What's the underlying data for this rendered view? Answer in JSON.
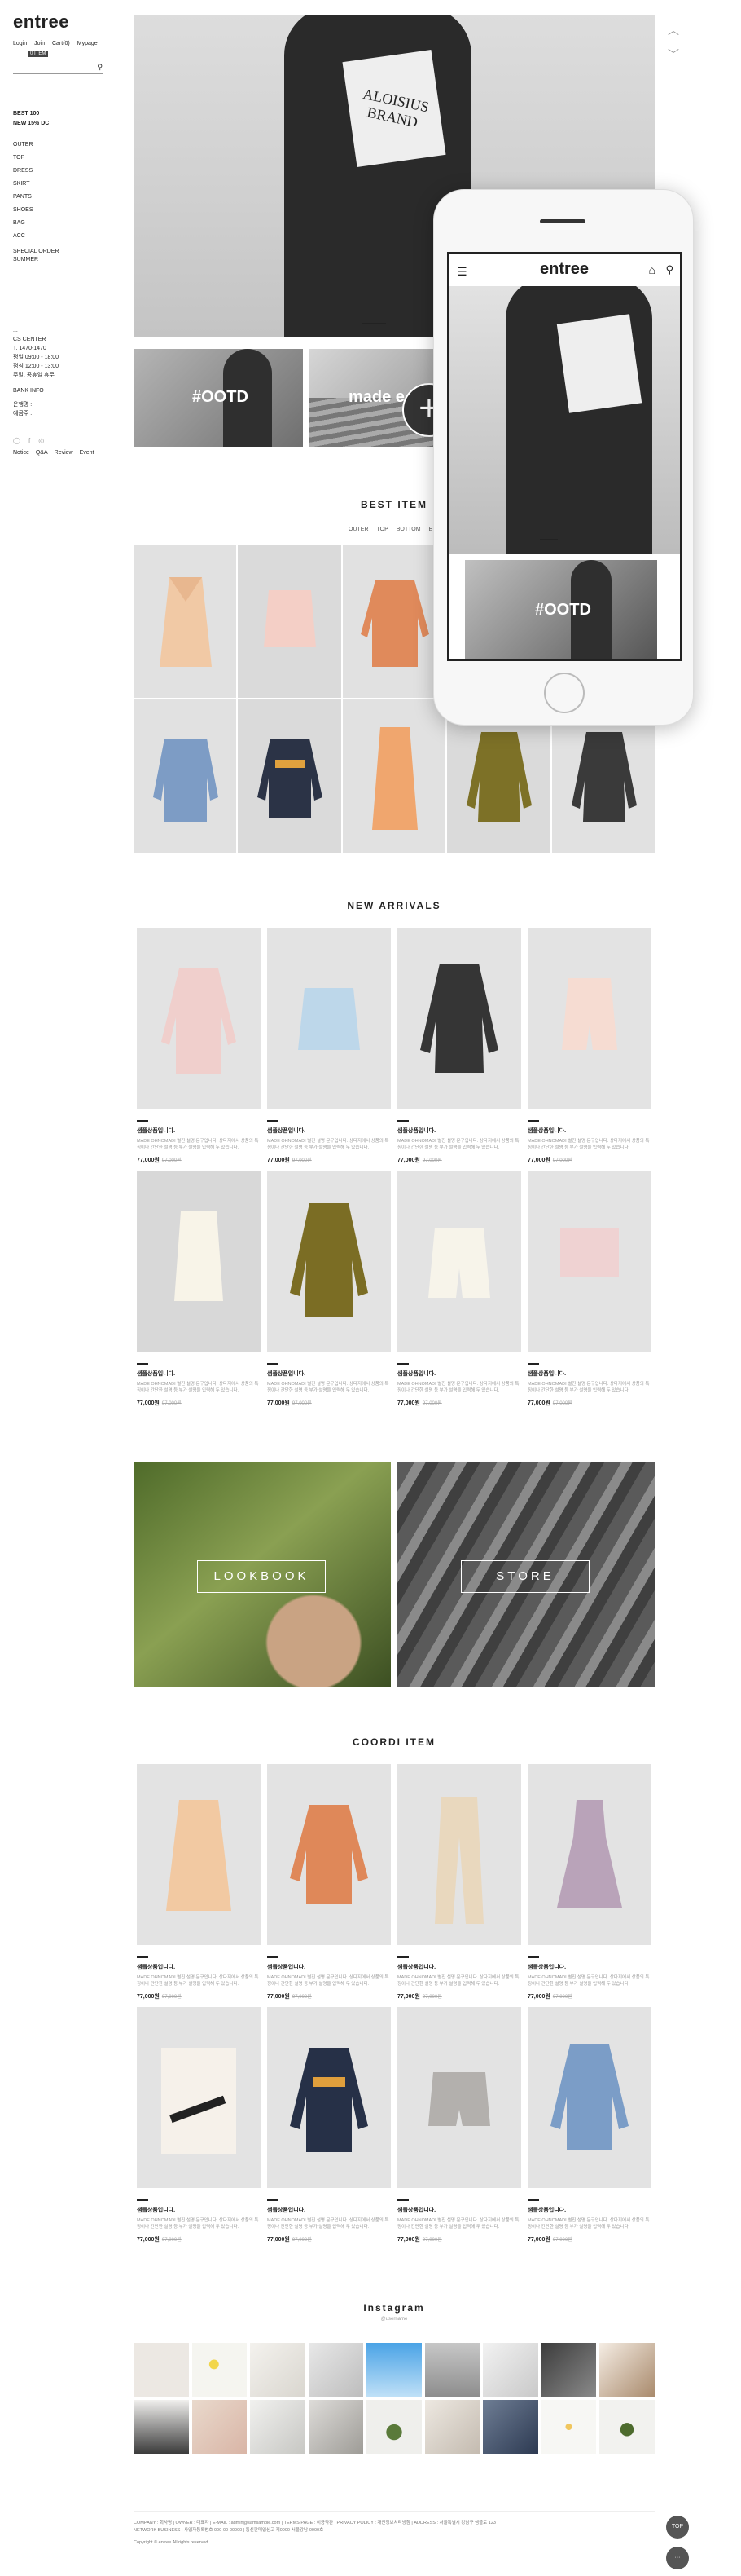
{
  "brand": {
    "logo": "entree",
    "mobile_logo": "entree"
  },
  "top_links": [
    "Login",
    "Join",
    "Cart(0)",
    "Mypage"
  ],
  "cart_badge": "0 ITEM",
  "sidebar_menu_primary": [
    "BEST 100",
    "NEW 15% DC"
  ],
  "sidebar_menu": [
    "OUTER",
    "TOP",
    "DRESS",
    "SKIRT",
    "PANTS",
    "SHOES",
    "BAG",
    "ACC",
    "SPECIAL ORDER",
    "SUMMER"
  ],
  "cs_center": {
    "dots": "...",
    "title": "CS CENTER",
    "phone": "T. 1470-1470",
    "hours": [
      "평일 09:00 - 18:00",
      "점심 12:00 - 13:00",
      "주말, 공휴일 휴무"
    ],
    "bank_title": "BANK INFO",
    "bank_lines": [
      "은행명 :",
      "예금주 :"
    ]
  },
  "sns": [
    "◯",
    "f",
    "◎"
  ],
  "bottom_links": [
    "Notice",
    "Q&A",
    "Review",
    "Event"
  ],
  "hero": {
    "print_text": "ALOISIUS BRAND"
  },
  "thumbs": [
    "#OOTD",
    "made e"
  ],
  "mobile_thumb": "#OOTD",
  "best_item": {
    "title": "BEST ITEM",
    "tabs": [
      "OUTER",
      "TOP",
      "BOTTOM",
      "E"
    ]
  },
  "new_arrivals": {
    "title": "NEW ARRIVALS",
    "products": [
      {
        "name": "샘플상품입니다.",
        "desc": "MADE OHNOMADI 별진 설명 문구입니다. 상다지에서 상품의 특징이나 간단한 설명 등 부가 설명을 입력해 두 있습니다.",
        "price": "77,000원",
        "orig": "97,000원"
      },
      {
        "name": "샘플상품입니다.",
        "desc": "MADE OHNOMADI 별진 설명 문구입니다. 상다지에서 상품의 특징이나 간단한 설명 등 부가 설명을 입력해 두 있습니다.",
        "price": "77,000원",
        "orig": "97,000원"
      },
      {
        "name": "샘플상품입니다.",
        "desc": "MADE OHNOMADI 별진 설명 문구입니다. 상다지에서 상품의 특징이나 간단한 설명 등 부가 설명을 입력해 두 있습니다.",
        "price": "77,000원",
        "orig": "97,000원"
      },
      {
        "name": "샘플상품입니다.",
        "desc": "MADE OHNOMADI 별진 설명 문구입니다. 상다지에서 상품의 특징이나 간단한 설명 등 부가 설명을 입력해 두 있습니다.",
        "price": "77,000원",
        "orig": "97,000원"
      },
      {
        "name": "샘플상품입니다.",
        "desc": "MADE OHNOMADI 별진 설명 문구입니다. 상다지에서 상품의 특징이나 간단한 설명 등 부가 설명을 입력해 두 있습니다.",
        "price": "77,000원",
        "orig": "97,000원"
      },
      {
        "name": "샘플상품입니다.",
        "desc": "MADE OHNOMADI 별진 설명 문구입니다. 상다지에서 상품의 특징이나 간단한 설명 등 부가 설명을 입력해 두 있습니다.",
        "price": "77,000원",
        "orig": "97,000원"
      },
      {
        "name": "샘플상품입니다.",
        "desc": "MADE OHNOMADI 별진 설명 문구입니다. 상다지에서 상품의 특징이나 간단한 설명 등 부가 설명을 입력해 두 있습니다.",
        "price": "77,000원",
        "orig": "97,000원"
      },
      {
        "name": "샘플상품입니다.",
        "desc": "MADE OHNOMADI 별진 설명 문구입니다. 상다지에서 상품의 특징이나 간단한 설명 등 부가 설명을 입력해 두 있습니다.",
        "price": "77,000원",
        "orig": "97,000원"
      }
    ]
  },
  "banners": {
    "lookbook": "LOOKBOOK",
    "store": "STORE"
  },
  "coordi_item": {
    "title": "COORDI ITEM",
    "products": [
      {
        "name": "샘플상품입니다.",
        "desc": "MADE OHNOMADI 별진 설명 문구입니다. 상다지에서 상품의 특징이나 간단한 설명 등 부가 설명을 입력해 두 있습니다.",
        "price": "77,000원",
        "orig": "97,000원"
      },
      {
        "name": "샘플상품입니다.",
        "desc": "MADE OHNOMADI 별진 설명 문구입니다. 상다지에서 상품의 특징이나 간단한 설명 등 부가 설명을 입력해 두 있습니다.",
        "price": "77,000원",
        "orig": "97,000원"
      },
      {
        "name": "샘플상품입니다.",
        "desc": "MADE OHNOMADI 별진 설명 문구입니다. 상다지에서 상품의 특징이나 간단한 설명 등 부가 설명을 입력해 두 있습니다.",
        "price": "77,000원",
        "orig": "97,000원"
      },
      {
        "name": "샘플상품입니다.",
        "desc": "MADE OHNOMADI 별진 설명 문구입니다. 상다지에서 상품의 특징이나 간단한 설명 등 부가 설명을 입력해 두 있습니다.",
        "price": "77,000원",
        "orig": "97,000원"
      },
      {
        "name": "샘플상품입니다.",
        "desc": "MADE OHNOMADI 별진 설명 문구입니다. 상다지에서 상품의 특징이나 간단한 설명 등 부가 설명을 입력해 두 있습니다.",
        "price": "77,000원",
        "orig": "97,000원"
      },
      {
        "name": "샘플상품입니다.",
        "desc": "MADE OHNOMADI 별진 설명 문구입니다. 상다지에서 상품의 특징이나 간단한 설명 등 부가 설명을 입력해 두 있습니다.",
        "price": "77,000원",
        "orig": "97,000원"
      },
      {
        "name": "샘플상품입니다.",
        "desc": "MADE OHNOMADI 별진 설명 문구입니다. 상다지에서 상품의 특징이나 간단한 설명 등 부가 설명을 입력해 두 있습니다.",
        "price": "77,000원",
        "orig": "97,000원"
      },
      {
        "name": "샘플상품입니다.",
        "desc": "MADE OHNOMADI 별진 설명 문구입니다. 상다지에서 상품의 특징이나 간단한 설명 등 부가 설명을 입력해 두 있습니다.",
        "price": "77,000원",
        "orig": "97,000원"
      }
    ]
  },
  "instagram": {
    "title": "Instagram",
    "handle": "@username"
  },
  "footer": {
    "line1": "COMPANY : 회사명  |  OWNER : 대표자  |  E-MAIL : admin@samsample.com  |  TERMS PAGE : 이용약관  |  PRIVACY POLICY : 개인정보처리방침  |  ADDRESS : 서울특별시 강남구 샘플로 123",
    "line2": "NETWORK BUSINESS : 사업자등록번호 000-00-00000  |  통신판매업신고 제0000-서울강남-0000호",
    "line3": "Copyright © entree All rights reserved."
  },
  "fabs": [
    "TOP",
    "···"
  ],
  "colors": {
    "accent": "#222222",
    "card_bg": "#e3e3e3",
    "muted": "#999999"
  }
}
